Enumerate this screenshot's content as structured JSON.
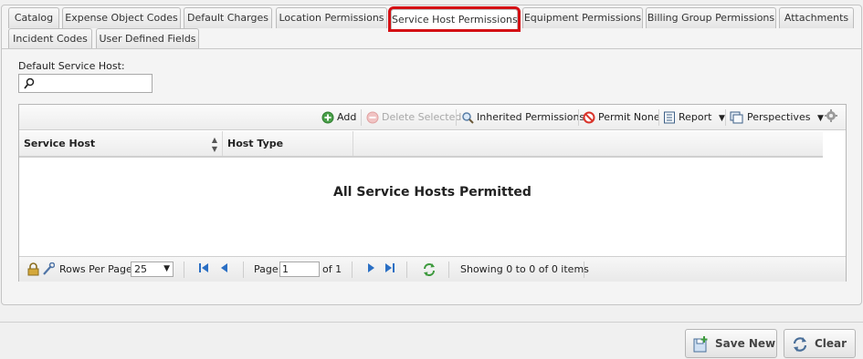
{
  "tabs_row1": [
    {
      "label": "Catalog"
    },
    {
      "label": "Expense Object Codes"
    },
    {
      "label": "Default Charges"
    },
    {
      "label": "Location Permissions"
    },
    {
      "label": "Service Host Permissions",
      "active": true
    },
    {
      "label": "Equipment Permissions"
    },
    {
      "label": "Billing Group Permissions"
    },
    {
      "label": "Attachments"
    }
  ],
  "tabs_row2": [
    {
      "label": "Incident Codes"
    },
    {
      "label": "User Defined Fields"
    }
  ],
  "default_host": {
    "label": "Default Service Host:",
    "value": ""
  },
  "toolbar": {
    "add": "Add",
    "delete_selected": "Delete Selected",
    "inherited": "Inherited Permissions",
    "permit_none": "Permit None",
    "report": "Report",
    "perspectives": "Perspectives"
  },
  "columns": [
    "Service Host",
    "Host Type"
  ],
  "empty_message": "All Service Hosts Permitted",
  "pager": {
    "rows_label": "Rows Per Page:",
    "rows_value": "25",
    "page_label": "Page:",
    "page_value": "1",
    "of_label": "of 1",
    "showing": "Showing 0 to 0 of 0 items"
  },
  "buttons": {
    "save_new": "Save New",
    "clear": "Clear"
  },
  "colors": {
    "active_tab_outline": "#d40f14",
    "add_green": "#4aa04a",
    "permit_none_red": "#d9342b",
    "nav_blue": "#2a6fc4"
  }
}
